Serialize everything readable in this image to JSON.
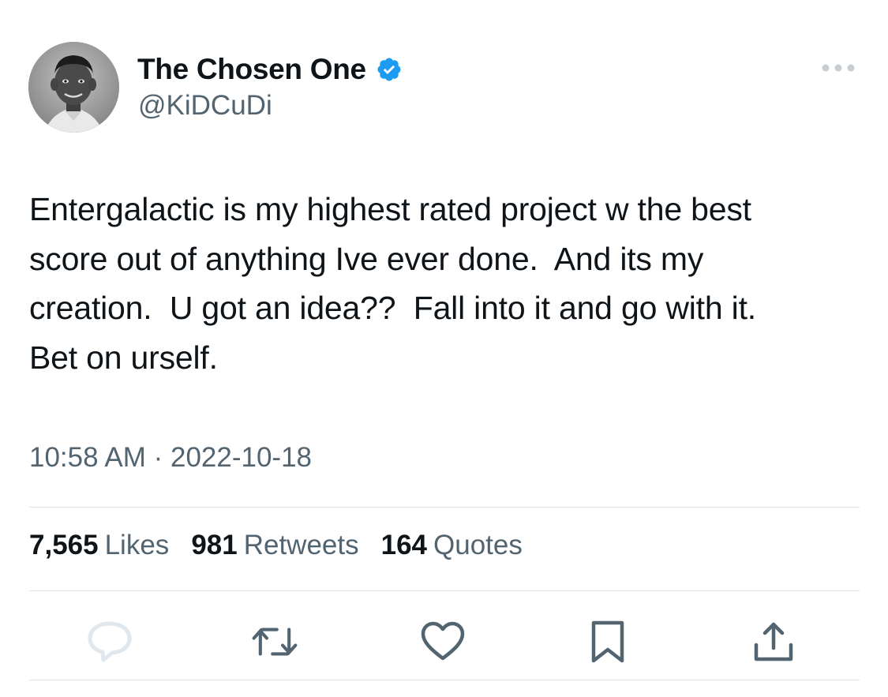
{
  "author": {
    "display_name": "The Chosen One",
    "handle": "@KiDCuDi",
    "verified": true,
    "verified_color": "#1d9bf0"
  },
  "tweet": {
    "text": "Entergalactic is my highest rated project w the best\nscore out of anything Ive ever done.  And its my\ncreation.  U got an idea??  Fall into it and go with it.\nBet on urself.",
    "timestamp": "10:58 AM · 2022-10-18"
  },
  "stats": {
    "likes": {
      "count": "7,565",
      "label": "Likes"
    },
    "retweets": {
      "count": "981",
      "label": "Retweets"
    },
    "quotes": {
      "count": "164",
      "label": "Quotes"
    }
  },
  "actions": {
    "icons": [
      "reply-icon",
      "retweet-icon",
      "like-icon",
      "bookmark-icon",
      "share-icon"
    ],
    "reply_color": "#e1e8ed",
    "icon_color": "#536471"
  },
  "colors": {
    "text_primary": "#0f1419",
    "text_secondary": "#536471",
    "divider": "#dfe3e6"
  }
}
